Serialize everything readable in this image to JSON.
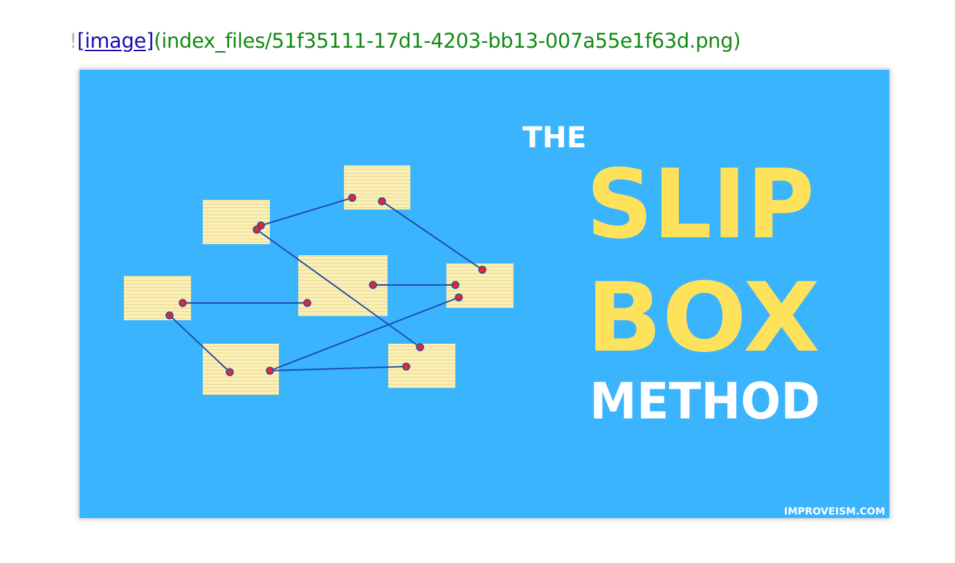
{
  "markdown": {
    "bang": "!",
    "link_text": "[image]",
    "url_text": "(index_files/51f35111-17d1-4203-bb13-007a55e1f63d.png)"
  },
  "image": {
    "title_the": "THE",
    "title_slip": "SLIP",
    "title_box": "BOX",
    "title_method": "METHOD",
    "credit": "IMPROVEISM.COM",
    "colors": {
      "background": "#3ab4fd",
      "accent_yellow": "#ffe25c",
      "note_fill": "#fcefb4",
      "note_lines": "#e4d79b",
      "connector": "#1f4aa8",
      "dot": "#e8262a",
      "white": "#ffffff"
    }
  }
}
